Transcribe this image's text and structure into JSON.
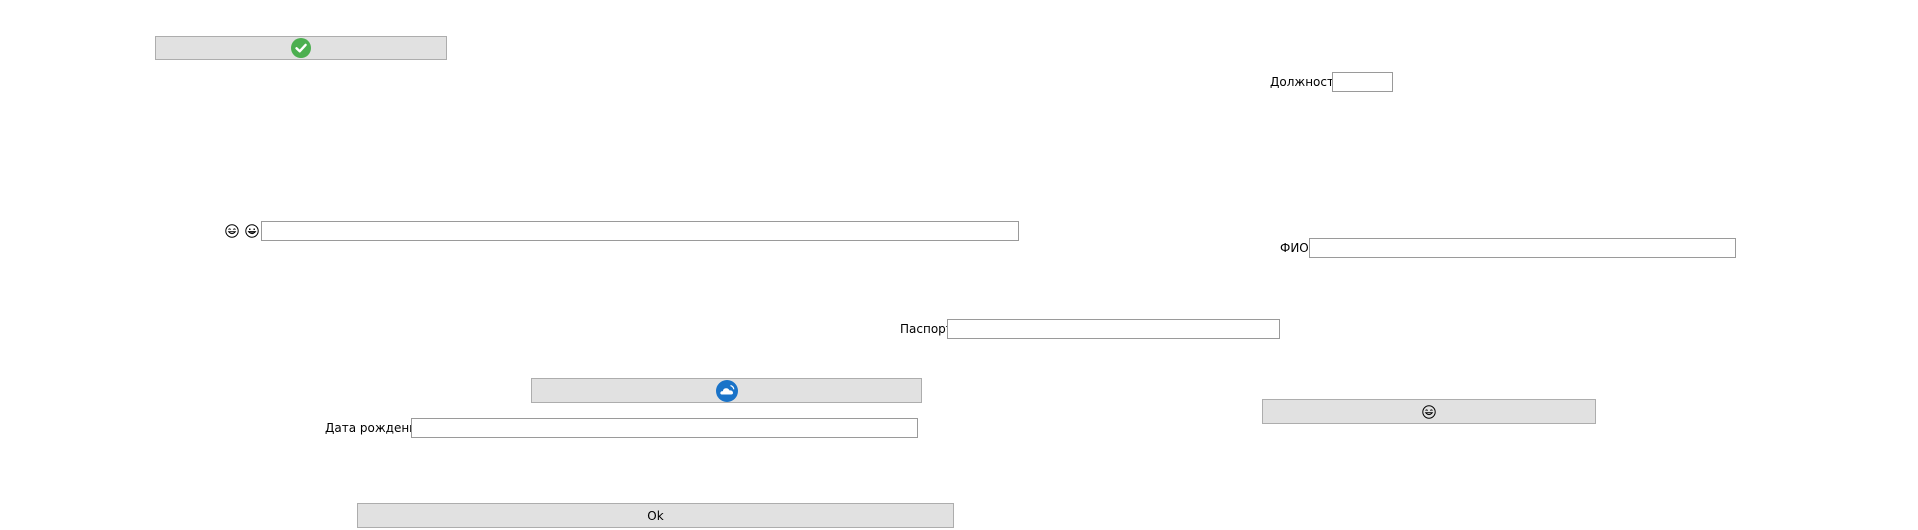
{
  "buttons": {
    "top_check": {
      "icon": "check-circle-icon"
    },
    "middle_cloud": {
      "icon": "cloud-sync-icon"
    },
    "right_emoji": {
      "icon": "grinning-face-icon"
    },
    "ok": {
      "label": "Ok"
    }
  },
  "fields": {
    "position": {
      "label": "Должность",
      "value": ""
    },
    "emoji_text": {
      "icons": [
        "tears-of-joy-face-icon",
        "grinning-face-icon"
      ],
      "value": ""
    },
    "full_name": {
      "label": "ФИО",
      "value": ""
    },
    "passport": {
      "label": "Паспорт",
      "value": ""
    },
    "birth_date": {
      "label": "Дата рождения",
      "value": ""
    }
  },
  "colors": {
    "button_bg": "#e1e1e1",
    "check_green": "#4caf50",
    "cloud_blue": "#1a73c8"
  }
}
